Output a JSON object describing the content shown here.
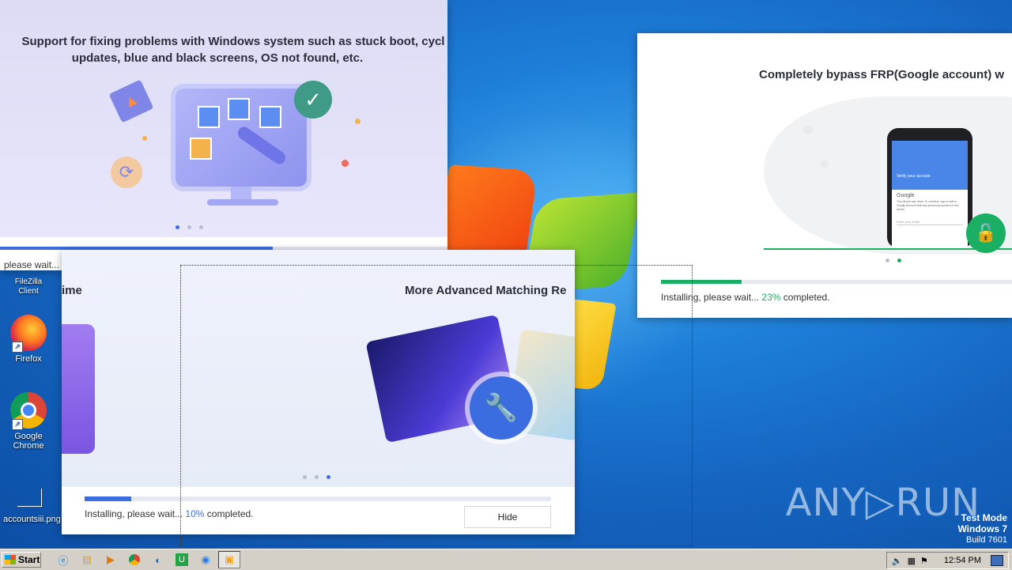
{
  "desktop": {
    "icons": [
      {
        "label": "FileZilla Client"
      },
      {
        "label": "Firefox"
      },
      {
        "label": "Google Chrome"
      },
      {
        "label": "accountsiii.png"
      }
    ],
    "watermark": "ANY▷RUN",
    "test_mode": {
      "line1": "Test Mode",
      "line2": "Windows 7",
      "line3": "Build 7601"
    }
  },
  "window_top_left": {
    "headline_line1": "Support for fixing problems with Windows system such as stuck boot, cycl",
    "headline_line2": "updates, blue and black screens, OS not found, etc.",
    "progress_fraction": 0.61,
    "status_text": "please wait..."
  },
  "window_bottom": {
    "heading_left": "ime",
    "heading_right": "More Advanced Matching Re",
    "status_prefix": "Installing, please wait...",
    "percent": "10%",
    "status_suffix": "completed.",
    "progress_fraction": 0.1,
    "hide_button": "Hide"
  },
  "window_right": {
    "headline": "Completely bypass FRP(Google account) w",
    "phone": {
      "verify_title": "Verify your account",
      "google_label": "Google",
      "body_text": "This device was reset. To continue, sign in with a Google Account that was previously synced on this device.",
      "email_placeholder": "Enter your email"
    },
    "status_prefix": "Installing, please wait...",
    "percent": "23%",
    "status_suffix": "completed.",
    "progress_fraction": 0.23
  },
  "taskbar": {
    "start_label": "Start",
    "clock": "12:54 PM"
  },
  "colors": {
    "accent_blue": "#3c6de0",
    "accent_green": "#1aaf62"
  }
}
